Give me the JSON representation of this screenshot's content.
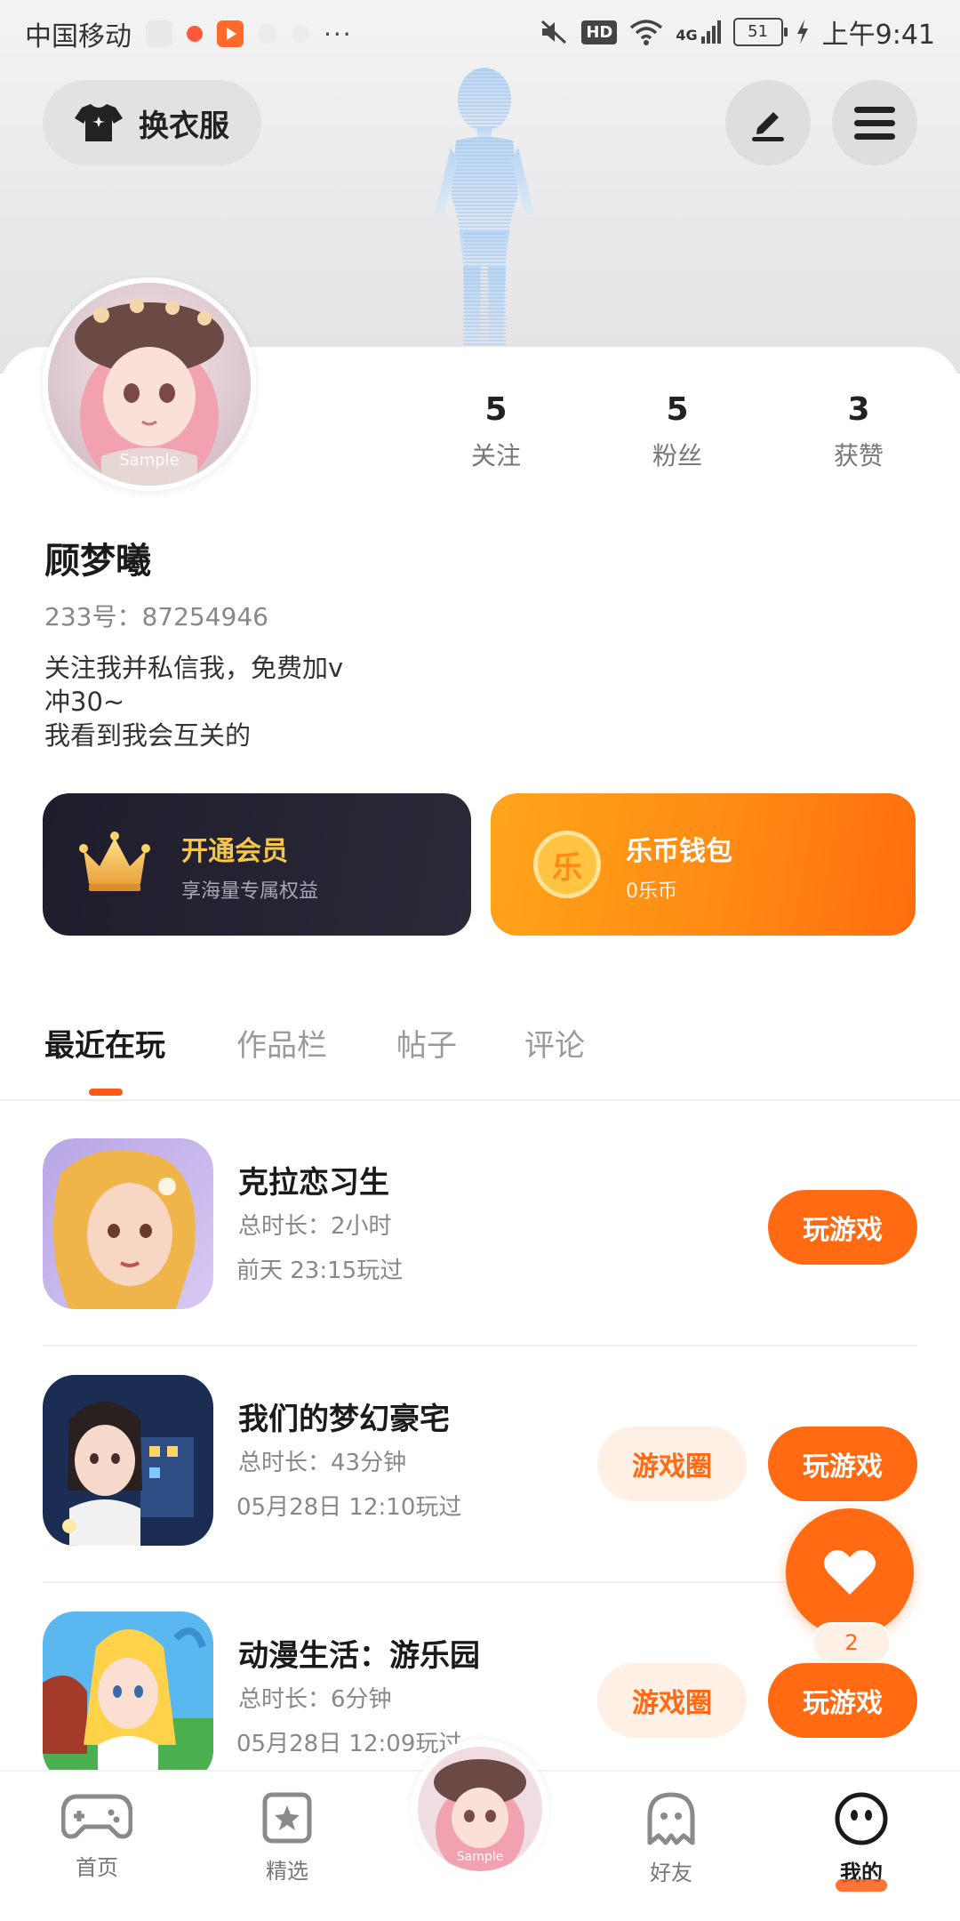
{
  "status_bar": {
    "carrier": "中国移动",
    "network": "4G",
    "hd": "HD",
    "battery": "51",
    "time": "上午9:41",
    "more": "···"
  },
  "header": {
    "outfit_label": "换衣服"
  },
  "profile": {
    "avatar_tag": "Sample",
    "name": "顾梦曦",
    "uid": "233号：87254946",
    "bio": [
      "关注我并私信我，免费加v",
      "冲30~",
      "我看到我会互关的"
    ],
    "stats": [
      {
        "value": "5",
        "label": "关注"
      },
      {
        "value": "5",
        "label": "粉丝"
      },
      {
        "value": "3",
        "label": "获赞"
      }
    ]
  },
  "promos": {
    "vip": {
      "title": "开通会员",
      "subtitle": "享海量专属权益"
    },
    "wallet": {
      "icon_char": "乐",
      "title": "乐币钱包",
      "subtitle": "0乐币"
    }
  },
  "tabs": [
    {
      "label": "最近在玩",
      "active": true
    },
    {
      "label": "作品栏",
      "active": false
    },
    {
      "label": "帖子",
      "active": false
    },
    {
      "label": "评论",
      "active": false
    }
  ],
  "games": [
    {
      "title": "克拉恋习生",
      "duration": "总时长：2小时",
      "last_played": "前天 23:15玩过",
      "play_label": "玩游戏",
      "circle_label": ""
    },
    {
      "title": "我们的梦幻豪宅",
      "duration": "总时长：43分钟",
      "last_played": "05月28日 12:10玩过",
      "play_label": "玩游戏",
      "circle_label": "游戏圈"
    },
    {
      "title": "动漫生活：游乐园",
      "duration": "总时长：6分钟",
      "last_played": "05月28日 12:09玩过",
      "play_label": "玩游戏",
      "circle_label": "游戏圈"
    }
  ],
  "floating": {
    "like_count": "2"
  },
  "bottom_nav": {
    "items": [
      {
        "label": "首页"
      },
      {
        "label": "精选"
      },
      {
        "label": "好友"
      },
      {
        "label": "我的"
      }
    ],
    "center_avatar_tag": "Sample"
  },
  "colors": {
    "accent": "#ff6a12",
    "vip_bg": "#24212f",
    "vip_text": "#f5c64b"
  }
}
